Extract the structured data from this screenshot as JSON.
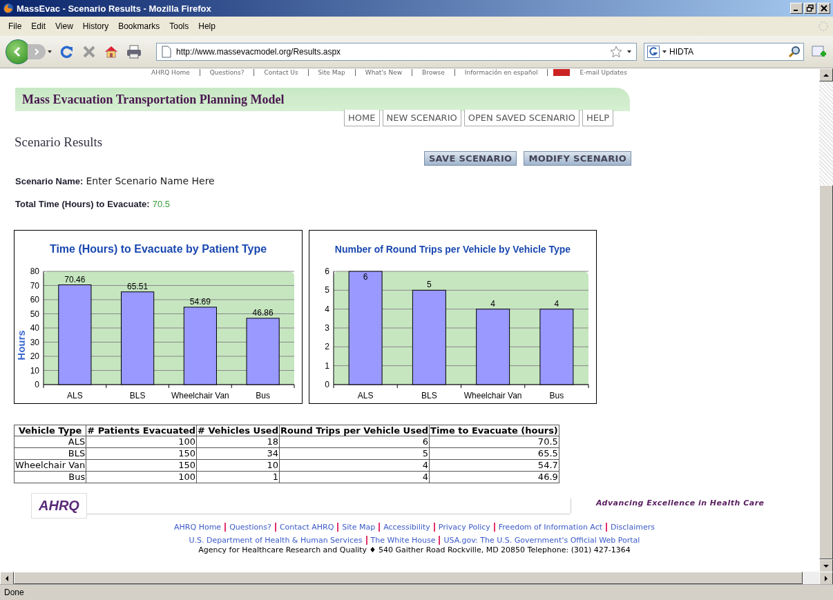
{
  "window": {
    "title": "MassEvac - Scenario Results - Mozilla Firefox"
  },
  "menu": [
    "File",
    "Edit",
    "View",
    "History",
    "Bookmarks",
    "Tools",
    "Help"
  ],
  "address_bar": {
    "value": "http://www.massevacmodel.org/Results.aspx"
  },
  "search_bar": {
    "value": "HIDTA"
  },
  "top_links": [
    "AHRQ Home",
    "Questions?",
    "Contact Us",
    "Site Map",
    "What's New",
    "Browse",
    "Información en español",
    "E-mail Updates"
  ],
  "banner": {
    "title": "Mass Evacuation Transportation Planning Model"
  },
  "nav": [
    "HOME",
    "NEW SCENARIO",
    "OPEN SAVED SCENARIO",
    "HELP"
  ],
  "page_title": "Scenario Results",
  "actions": [
    "SAVE SCENARIO",
    "MODIFY SCENARIO"
  ],
  "scenario_name": {
    "label": "Scenario Name:",
    "value": "Enter Scenario Name Here"
  },
  "total_time": {
    "label": "Total Time (Hours) to Evacuate:",
    "value": "70.5"
  },
  "charts": [
    {
      "chart_data": {
        "type": "bar",
        "title": "Time (Hours) to Evacuate by Patient Type",
        "ylabel": "Hours",
        "categories": [
          "ALS",
          "BLS",
          "Wheelchair Van",
          "Bus"
        ],
        "series": [
          {
            "color": "#9999ff",
            "values": [
              70.46,
              65.51,
              54.69,
              46.86
            ]
          }
        ],
        "grid": true,
        "ylim": [
          0,
          80
        ],
        "yticks": [
          0,
          10,
          20,
          30,
          40,
          50,
          60,
          70,
          80
        ],
        "data_labels": true
      }
    },
    {
      "chart_data": {
        "type": "bar",
        "title": "Number of Round Trips per Vehicle by Vehicle Type",
        "categories": [
          "ALS",
          "BLS",
          "Wheelchair Van",
          "Bus"
        ],
        "series": [
          {
            "color": "#9999ff",
            "values": [
              6,
              5,
              4,
              4
            ]
          }
        ],
        "grid": true,
        "ylim": [
          0,
          6
        ],
        "yticks": [
          0,
          1,
          2,
          3,
          4,
          5,
          6
        ],
        "data_labels": true
      }
    }
  ],
  "table": {
    "columns": [
      "Vehicle Type",
      "# Patients Evacuated",
      "# Vehicles Used",
      "Round Trips per Vehicle Used",
      "Time to Evacuate (hours)"
    ],
    "rows": [
      [
        "ALS",
        "100",
        "18",
        "6",
        "70.5"
      ],
      [
        "BLS",
        "150",
        "34",
        "5",
        "65.5"
      ],
      [
        "Wheelchair Van",
        "150",
        "10",
        "4",
        "54.7"
      ],
      [
        "Bus",
        "100",
        "1",
        "4",
        "46.9"
      ]
    ]
  },
  "footer": {
    "logo": "AHRQ",
    "tagline": "Advancing Excellence in Health Care",
    "link_rows": [
      [
        "AHRQ Home",
        "Questions?",
        "Contact AHRQ",
        "Site Map",
        "Accessibility",
        "Privacy Policy",
        "Freedom of Information Act",
        "Disclaimers"
      ],
      [
        "U.S. Department of Health & Human Services",
        "The White House",
        "USA.gov: The U.S. Government's Official Web Portal"
      ]
    ],
    "address": "Agency for Healthcare Research and Quality ♦ 540 Gaither Road Rockville, MD 20850 Telephone: (301) 427-1364"
  },
  "status_bar": {
    "text": "Done"
  }
}
